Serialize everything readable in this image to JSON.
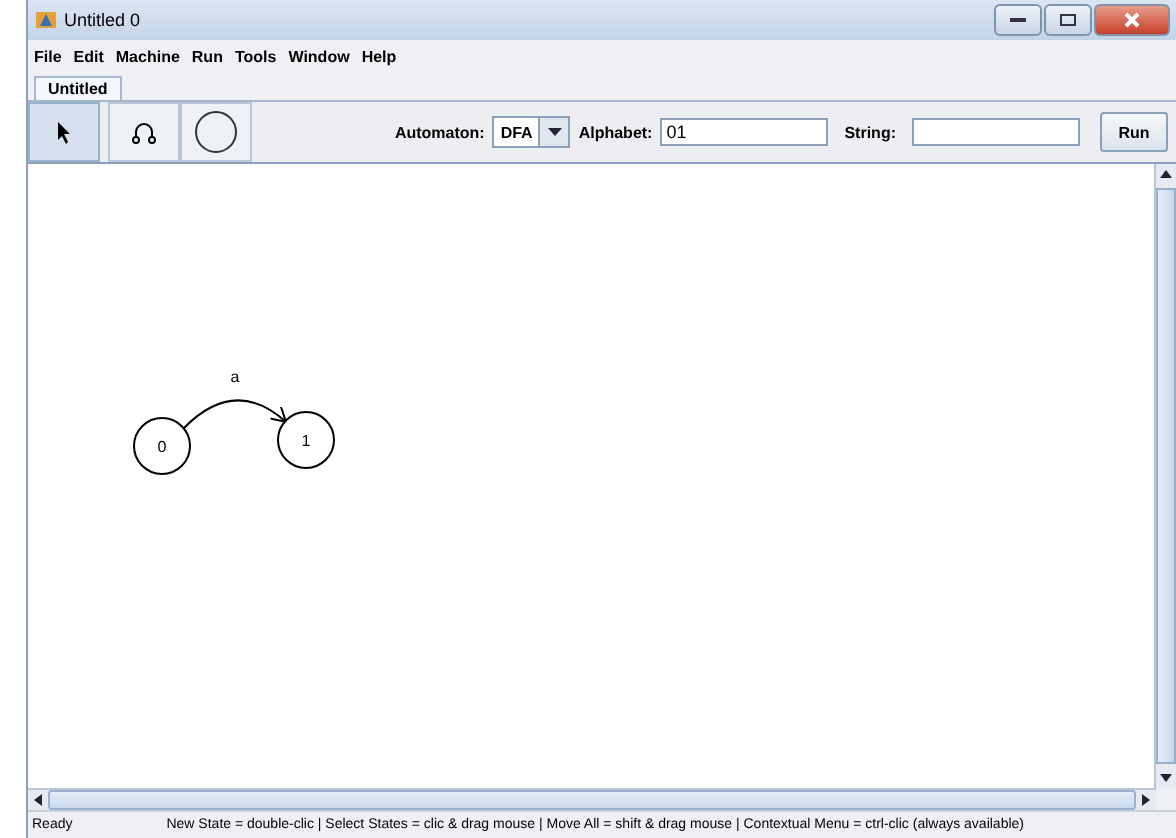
{
  "window": {
    "title": "Untitled 0"
  },
  "menu": [
    "File",
    "Edit",
    "Machine",
    "Run",
    "Tools",
    "Window",
    "Help"
  ],
  "tabs": [
    {
      "label": "Untitled",
      "selected": true
    }
  ],
  "tools": [
    {
      "kind": "select",
      "selected": true
    },
    {
      "kind": "transition",
      "selected": false
    },
    {
      "kind": "state",
      "selected": false
    }
  ],
  "automaton": {
    "label": "Automaton:",
    "value": "DFA"
  },
  "alphabet": {
    "label": "Alphabet:",
    "value": "01"
  },
  "string": {
    "label": "String:"
  },
  "run_button": "Run",
  "diagram": {
    "states": [
      {
        "label": "0"
      },
      {
        "label": "1"
      }
    ],
    "transitions": [
      {
        "label": "a"
      }
    ]
  },
  "status_bar": {
    "state": "Ready",
    "hint": "New State = double-clic | Select States = clic & drag mouse | Move All = shift & drag mouse | Contextual Menu = ctrl-clic (always available)"
  }
}
